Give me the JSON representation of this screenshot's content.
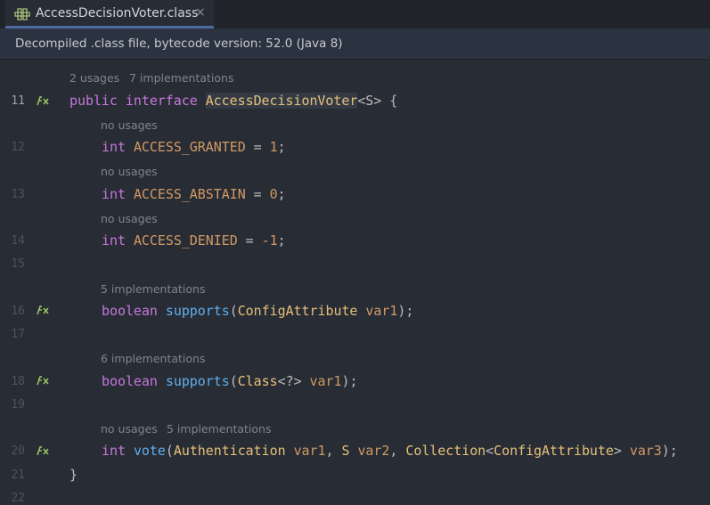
{
  "tab": {
    "title": "AccessDecisionVoter.class",
    "close": "×"
  },
  "banner": {
    "text": "Decompiled .class file, bytecode version: 52.0 (Java 8)"
  },
  "hints": {
    "h11a": "2 usages",
    "h11b": "7 implementations",
    "h12": "no usages",
    "h13": "no usages",
    "h14": "no usages",
    "h16": "5 implementations",
    "h18": "6 implementations",
    "h20a": "no usages",
    "h20b": "5 implementations"
  },
  "line_numbers": [
    "11",
    "12",
    "13",
    "14",
    "15",
    "16",
    "17",
    "18",
    "19",
    "20",
    "21",
    "22"
  ],
  "code": {
    "l11": {
      "kw1": "public",
      "kw2": "interface",
      "name": "AccessDecisionVoter",
      "rest": "<S> {"
    },
    "l12": {
      "type": "int",
      "name": "ACCESS_GRANTED",
      "eq": " = ",
      "val": "1",
      "end": ";"
    },
    "l13": {
      "type": "int",
      "name": "ACCESS_ABSTAIN",
      "eq": " = ",
      "val": "0",
      "end": ";"
    },
    "l14": {
      "type": "int",
      "name": "ACCESS_DENIED",
      "eq": " = ",
      "val": "-1",
      "end": ";"
    },
    "l16": {
      "type": "boolean",
      "meth": "supports",
      "p1": "(",
      "ptype": "ConfigAttribute",
      "pname": "var1",
      "end": ");"
    },
    "l18": {
      "type": "boolean",
      "meth": "supports",
      "p1": "(",
      "ptype": "Class",
      "gen": "<?>",
      "pname": "var1",
      "end": ");"
    },
    "l20": {
      "type": "int",
      "meth": "vote",
      "p1": "(",
      "t1": "Authentication",
      "n1": "var1",
      "c1": ", ",
      "t2": "S",
      "n2": "var2",
      "c2": ", ",
      "t3": "Collection",
      "lt": "<",
      "t4": "ConfigAttribute",
      "gt": ">",
      "n3": "var3",
      "end": ");"
    },
    "l21": {
      "text": "}"
    }
  },
  "colors": {
    "keyword": "#c678dd",
    "type": "#e5c07b",
    "constant": "#d19a66",
    "method": "#61afef",
    "hint": "#7f848e"
  },
  "gutter_icon": "implemented-method-icon",
  "tab_icon": "class-structure-icon"
}
